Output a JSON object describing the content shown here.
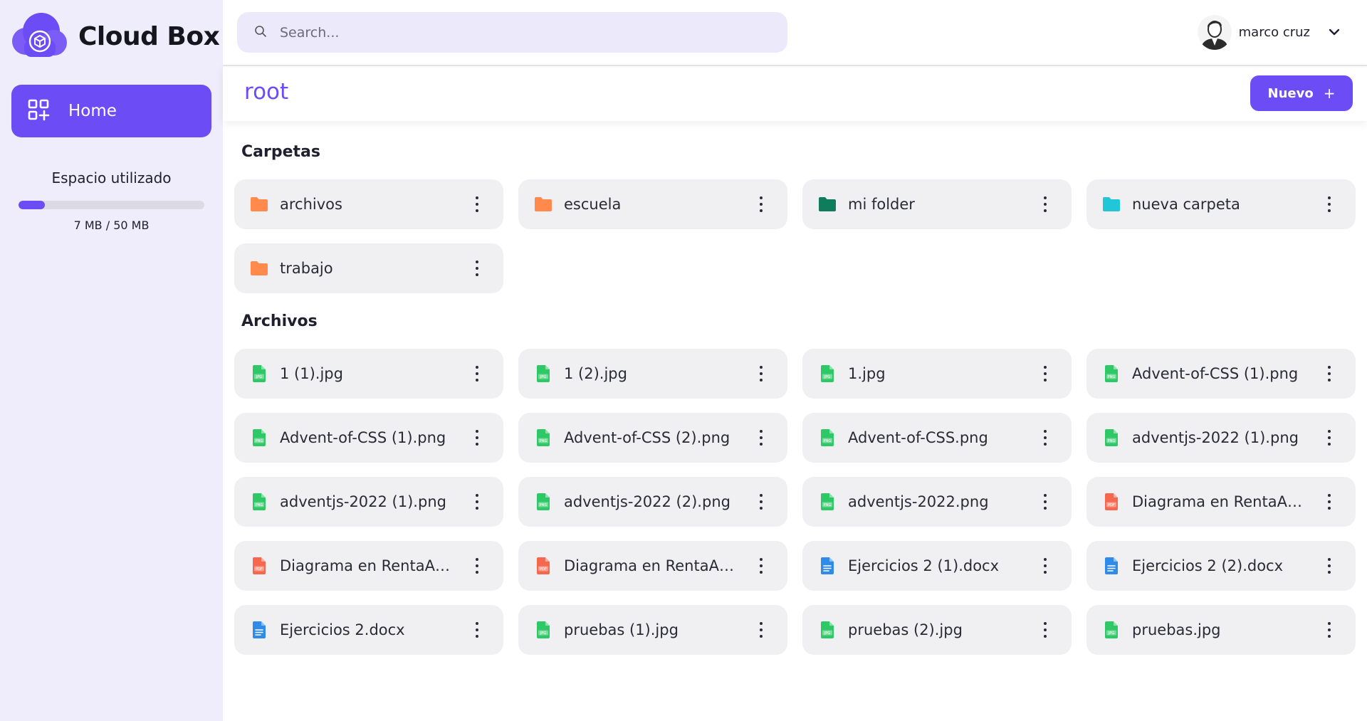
{
  "app": {
    "name": "Cloud Box"
  },
  "sidebar": {
    "home_label": "Home",
    "storage": {
      "title": "Espacio utilizado",
      "used_text": "7 MB / 50 MB",
      "used_fraction": 0.14
    }
  },
  "search": {
    "placeholder": "Search...",
    "value": ""
  },
  "user": {
    "name": "marco cruz"
  },
  "breadcrumb": {
    "current": "root"
  },
  "toolbar": {
    "new_label": "Nuevo",
    "new_icon": "+"
  },
  "folders": {
    "title": "Carpetas",
    "items": [
      {
        "name": "archivos",
        "color": "#ff8a4c"
      },
      {
        "name": "escuela",
        "color": "#ff8a4c"
      },
      {
        "name": "mi folder",
        "color": "#0f7d5b"
      },
      {
        "name": "nueva carpeta",
        "color": "#22c6d9"
      },
      {
        "name": "trabajo",
        "color": "#ff8a4c"
      }
    ]
  },
  "files": {
    "title": "Archivos",
    "items": [
      {
        "name": "1 (1).jpg",
        "type": "jpg"
      },
      {
        "name": "1 (2).jpg",
        "type": "jpg"
      },
      {
        "name": "1.jpg",
        "type": "jpg"
      },
      {
        "name": "Advent-of-CSS (1).png",
        "type": "png"
      },
      {
        "name": "Advent-of-CSS (1).png",
        "type": "png"
      },
      {
        "name": "Advent-of-CSS (2).png",
        "type": "png"
      },
      {
        "name": "Advent-of-CSS.png",
        "type": "png"
      },
      {
        "name": "adventjs-2022 (1).png",
        "type": "png"
      },
      {
        "name": "adventjs-2022 (1).png",
        "type": "png"
      },
      {
        "name": "adventjs-2022 (2).png",
        "type": "png"
      },
      {
        "name": "adventjs-2022.png",
        "type": "png"
      },
      {
        "name": "Diagrama en RentaAu...",
        "type": "pdf"
      },
      {
        "name": "Diagrama en RentaAu...",
        "type": "pdf"
      },
      {
        "name": "Diagrama en RentaAu...",
        "type": "pdf"
      },
      {
        "name": "Ejercicios 2 (1).docx",
        "type": "docx"
      },
      {
        "name": "Ejercicios 2 (2).docx",
        "type": "docx"
      },
      {
        "name": "Ejercicios 2.docx",
        "type": "docx"
      },
      {
        "name": "pruebas (1).jpg",
        "type": "jpg"
      },
      {
        "name": "pruebas (2).jpg",
        "type": "jpg"
      },
      {
        "name": "pruebas.jpg",
        "type": "jpg"
      }
    ]
  },
  "icons": {
    "logo": "cloud-box-logo-icon",
    "home": "dashboard-grid-icon",
    "search": "search-icon",
    "avatar": "user-avatar-icon",
    "user_menu": "chevron-down-icon",
    "folder": "folder-icon",
    "jpg": "image-file-icon",
    "png": "image-file-icon",
    "pdf": "pdf-file-icon",
    "docx": "document-file-icon",
    "menu": "more-vertical-icon"
  },
  "colors": {
    "accent": "#6c4cf5",
    "sidebar_bg": "#efedfb",
    "card_bg": "#f0f0f3",
    "image_file": "#2ec866",
    "pdf_file": "#f5674f",
    "doc_file": "#2f8ae8"
  }
}
